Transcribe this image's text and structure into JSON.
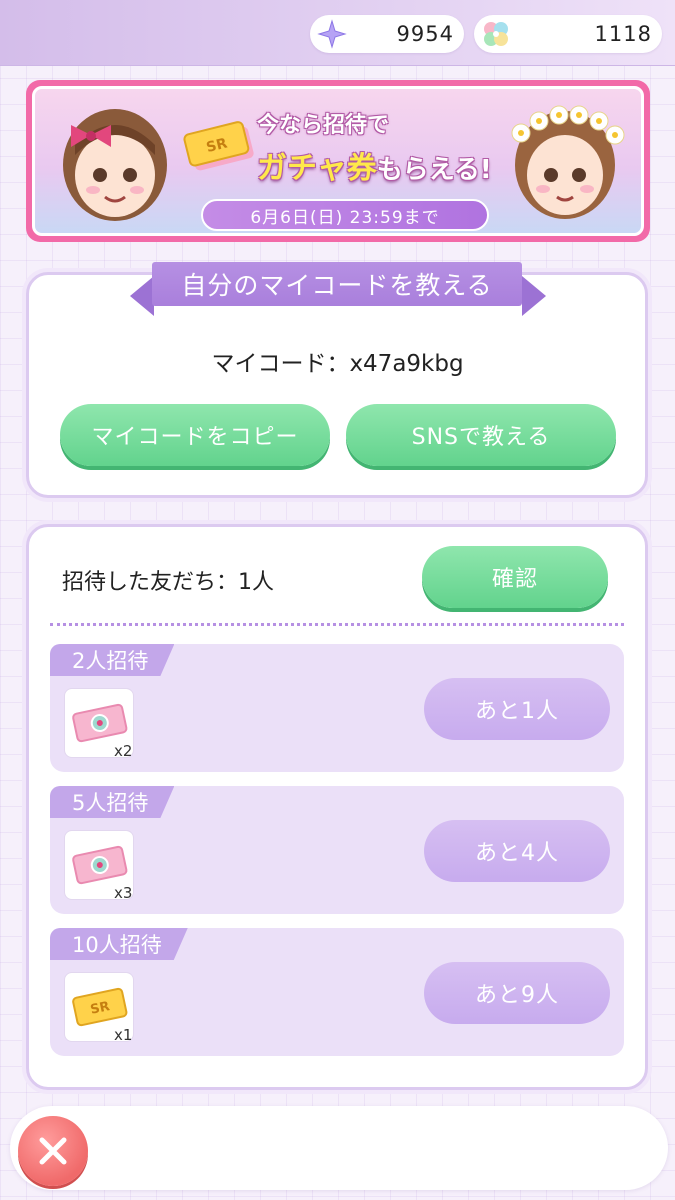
{
  "currencies": {
    "star": {
      "icon": "sparkle-star-icon",
      "value": "9954"
    },
    "clover": {
      "icon": "clover-icon",
      "value": "1118"
    }
  },
  "banner": {
    "line1": "今なら招待で",
    "line2_highlight": "ガチャ券",
    "line2_rest": "もらえる!",
    "date": "6月6日(日) 23:59まで",
    "ticket_label": "SR"
  },
  "mycode_section": {
    "title": "自分のマイコードを教える",
    "code_text": "マイコード：x47a9kbg",
    "copy_button": "マイコードをコピー",
    "sns_button": "SNSで教える"
  },
  "invite_section": {
    "invited_text": "招待した友だち：1人",
    "confirm_button": "確認",
    "tiers": [
      {
        "tag": "2人招待",
        "item": "pink-ticket-icon",
        "count": "x2",
        "button": "あと1人"
      },
      {
        "tag": "5人招待",
        "item": "pink-ticket-icon",
        "count": "x3",
        "button": "あと4人"
      },
      {
        "tag": "10人招待",
        "item": "sr-ticket-icon",
        "count": "x1",
        "ticket_label": "SR",
        "button": "あと9人"
      }
    ]
  },
  "colors": {
    "accent_purple": "#b690e3",
    "green_button": "#62d38d",
    "banner_border": "#f26aa8",
    "close_red": "#f06a6a"
  }
}
